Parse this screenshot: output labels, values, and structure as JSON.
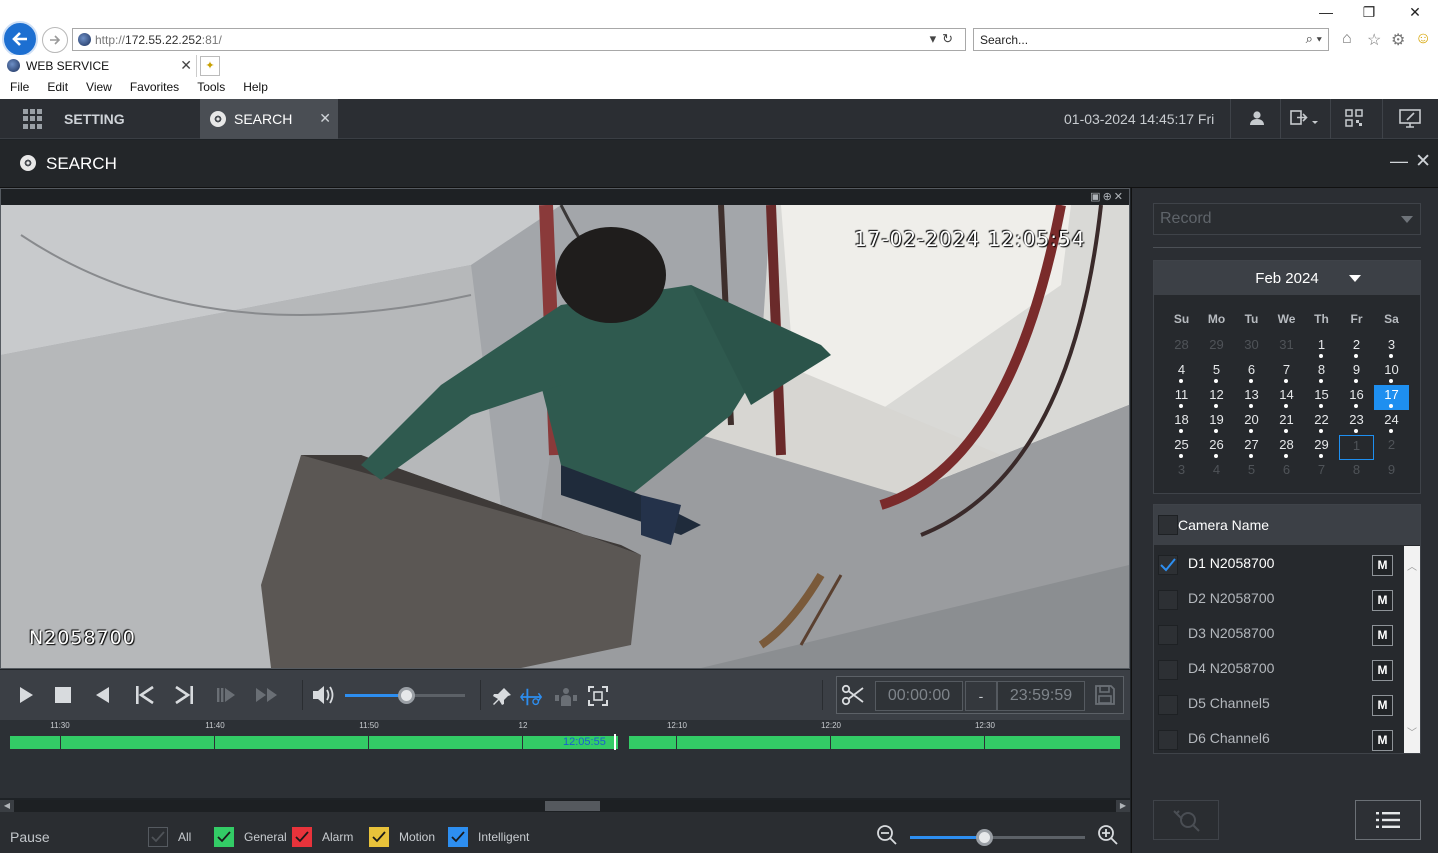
{
  "browser": {
    "url_prefix": "http://",
    "url_host": "172.55.22.252",
    "url_suffix": ":81/",
    "search_placeholder": "Search...",
    "tab_title": "WEB SERVICE",
    "menu": [
      "File",
      "Edit",
      "View",
      "Favorites",
      "Tools",
      "Help"
    ]
  },
  "topbar": {
    "setting_label": "SETTING",
    "search_tab_label": "SEARCH",
    "datetime": "01-03-2024 14:45:17 Fri"
  },
  "search_panel": {
    "title": "SEARCH"
  },
  "video": {
    "osd_time": "17-02-2024 12:05:54",
    "osd_name": "N2058700"
  },
  "controls": {
    "volume_level": 0.52,
    "clip_start": "00:00:00",
    "clip_separator": "-",
    "clip_end": "23:59:59"
  },
  "timeline": {
    "ticks": [
      "11:30",
      "11:40",
      "11:50",
      "12",
      "12:10",
      "12:20",
      "12:30"
    ],
    "cursor_time": "12:05:55",
    "record_color": "#33cc66"
  },
  "status": {
    "state": "Pause",
    "zoom_level": 0.43,
    "legend": [
      {
        "label": "All",
        "color": "#2a2d31",
        "checked": false
      },
      {
        "label": "General",
        "color": "#33cc66",
        "checked": true
      },
      {
        "label": "Alarm",
        "color": "#e8333b",
        "checked": true
      },
      {
        "label": "Motion",
        "color": "#e8c23a",
        "checked": true
      },
      {
        "label": "Intelligent",
        "color": "#2d8ef0",
        "checked": true
      }
    ]
  },
  "record_type": {
    "placeholder": "Record"
  },
  "calendar": {
    "month_label": "Feb 2024",
    "weekdays": [
      "Su",
      "Mo",
      "Tu",
      "We",
      "Th",
      "Fr",
      "Sa"
    ],
    "weeks": [
      [
        {
          "d": "28",
          "o": 1
        },
        {
          "d": "29",
          "o": 1
        },
        {
          "d": "30",
          "o": 1
        },
        {
          "d": "31",
          "o": 1
        },
        {
          "d": "1",
          "r": 1
        },
        {
          "d": "2",
          "r": 1
        },
        {
          "d": "3",
          "r": 1
        }
      ],
      [
        {
          "d": "4",
          "r": 1
        },
        {
          "d": "5",
          "r": 1
        },
        {
          "d": "6",
          "r": 1
        },
        {
          "d": "7",
          "r": 1
        },
        {
          "d": "8",
          "r": 1
        },
        {
          "d": "9",
          "r": 1
        },
        {
          "d": "10",
          "r": 1
        }
      ],
      [
        {
          "d": "11",
          "r": 1
        },
        {
          "d": "12",
          "r": 1
        },
        {
          "d": "13",
          "r": 1
        },
        {
          "d": "14",
          "r": 1
        },
        {
          "d": "15",
          "r": 1
        },
        {
          "d": "16",
          "r": 1
        },
        {
          "d": "17",
          "r": 1,
          "s": 1
        }
      ],
      [
        {
          "d": "18",
          "r": 1
        },
        {
          "d": "19",
          "r": 1
        },
        {
          "d": "20",
          "r": 1
        },
        {
          "d": "21",
          "r": 1
        },
        {
          "d": "22",
          "r": 1
        },
        {
          "d": "23",
          "r": 1
        },
        {
          "d": "24",
          "r": 1
        }
      ],
      [
        {
          "d": "25",
          "r": 1
        },
        {
          "d": "26",
          "r": 1
        },
        {
          "d": "27",
          "r": 1
        },
        {
          "d": "28",
          "r": 1
        },
        {
          "d": "29",
          "r": 1
        },
        {
          "d": "1",
          "o": 1,
          "t": 1
        },
        {
          "d": "2",
          "o": 1
        }
      ],
      [
        {
          "d": "3",
          "o": 1
        },
        {
          "d": "4",
          "o": 1
        },
        {
          "d": "5",
          "o": 1
        },
        {
          "d": "6",
          "o": 1
        },
        {
          "d": "7",
          "o": 1
        },
        {
          "d": "8",
          "o": 1
        },
        {
          "d": "9",
          "o": 1
        }
      ]
    ],
    "selected_color": "#1e8ff0"
  },
  "cameras": {
    "header": "Camera Name",
    "mode_label": "M",
    "list": [
      {
        "name": "D1 N2058700",
        "checked": true
      },
      {
        "name": "D2 N2058700",
        "checked": false
      },
      {
        "name": "D3 N2058700",
        "checked": false
      },
      {
        "name": "D4 N2058700",
        "checked": false
      },
      {
        "name": "D5 Channel5",
        "checked": false
      },
      {
        "name": "D6 Channel6",
        "checked": false
      }
    ]
  },
  "icons": {
    "back": "back-arrow-icon",
    "forward": "forward-arrow-icon",
    "grid": "grid-icon",
    "film": "film-reel-icon",
    "user": "user-icon",
    "logout": "logout-icon",
    "qrcode": "qrcode-icon",
    "display": "display-icon",
    "scissors": "scissors-icon",
    "save": "save-icon",
    "zoom_out": "zoom-out-icon",
    "zoom_in": "zoom-in-icon",
    "list": "list-icon",
    "smart_search": "smart-search-icon"
  }
}
